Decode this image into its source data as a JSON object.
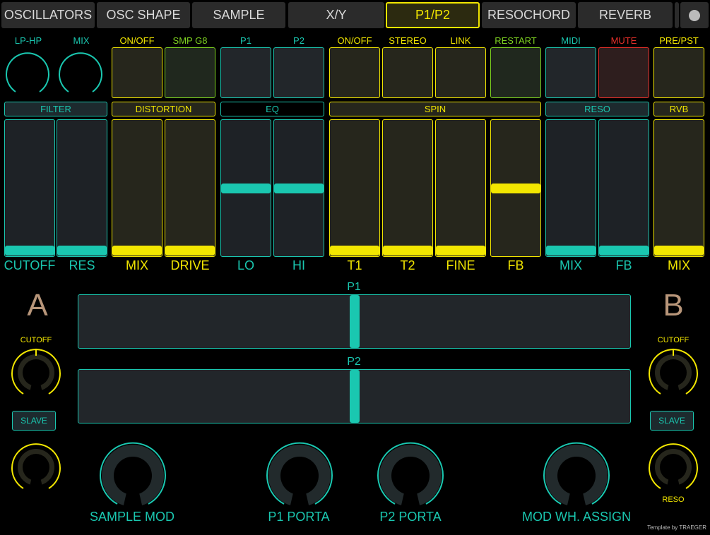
{
  "colors": {
    "teal": "#1ac7b0",
    "yellow": "#f2e600",
    "green": "#7ed321",
    "red": "#e8302a",
    "brown": "#b8967a"
  },
  "tabs": [
    {
      "label": "OSCILLATORS"
    },
    {
      "label": "OSC SHAPE"
    },
    {
      "label": "SAMPLE"
    },
    {
      "label": "X/Y"
    },
    {
      "label": "P1/P2",
      "active": true
    },
    {
      "label": "RESOCHORD"
    },
    {
      "label": "REVERB"
    }
  ],
  "top_labels": {
    "lp_hp": "LP-HP",
    "mix": "MIX",
    "onoff1": "ON/OFF",
    "smp_g8": "SMP G8",
    "p1": "P1",
    "p2": "P2",
    "onoff2": "ON/OFF",
    "stereo": "STEREO",
    "link": "LINK",
    "restart": "RESTART",
    "midi": "MIDI",
    "mute": "MUTE",
    "pre_pst": "PRE/PST"
  },
  "sections": {
    "filter": "FILTER",
    "distortion": "DISTORTION",
    "eq": "EQ",
    "spin": "SPIN",
    "reso": "RESO",
    "rvb": "RVB"
  },
  "faders": [
    {
      "label": "CUTOFF",
      "value": 0.04
    },
    {
      "label": "RES",
      "value": 0.04
    },
    {
      "label": "MIX",
      "value": 0.04
    },
    {
      "label": "DRIVE",
      "value": 0.04
    },
    {
      "label": "LO",
      "value": 0.5
    },
    {
      "label": "HI",
      "value": 0.5
    },
    {
      "label": "T1",
      "value": 0.04
    },
    {
      "label": "T2",
      "value": 0.04
    },
    {
      "label": "FINE",
      "value": 0.04
    },
    {
      "label": "FB",
      "value": 0.5
    },
    {
      "label": "MIX",
      "value": 0.04
    },
    {
      "label": "FB",
      "value": 0.04
    },
    {
      "label": "MIX",
      "value": 0.04
    }
  ],
  "xy": {
    "p1_label": "P1",
    "p2_label": "P2",
    "p1_value": 0.5,
    "p2_value": 0.5
  },
  "side": {
    "a": "A",
    "b": "B",
    "cutoff_a": "CUTOFF",
    "cutoff_b": "CUTOFF",
    "slave_a": "SLAVE",
    "slave_b": "SLAVE",
    "reso_b": "RESO"
  },
  "bottom": {
    "sample_mod": "SAMPLE MOD",
    "p1_porta": "P1 PORTA",
    "p2_porta": "P2 PORTA",
    "mod_wh": "MOD WH. ASSIGN"
  },
  "footer": "Template by TRAEGER"
}
